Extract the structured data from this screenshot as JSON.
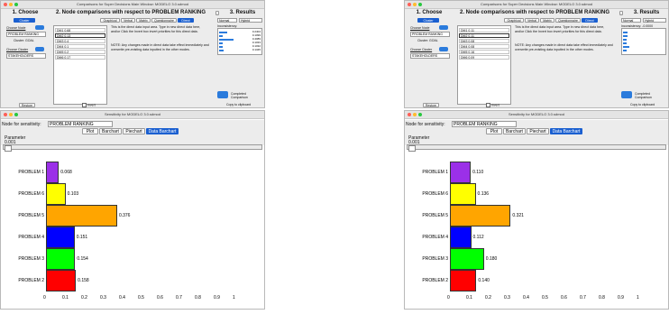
{
  "panels": [
    {
      "id": "left",
      "comparisons": {
        "window_title": "Comparisons for Super Decisions Main Window: MODELO 3.0.sdmod",
        "choose_header": "1. Choose",
        "node_header": "2. Node comparisons with respect to PROBLEM RANKING",
        "results_header": "3. Results",
        "cluster_tab": "Cluster",
        "view_tabs": [
          "Graphical",
          "Verbal",
          "Matrix",
          "Questionnaire",
          "Direct"
        ],
        "choose_node_label": "Choose Node",
        "node_value": "PROBLEM RANKING",
        "cluster_label": "Cluster: GOAL",
        "choose_cluster_label": "Choose Cluster",
        "cluster_value": "STAKEHOLDERS",
        "entries": [
          {
            "name": "DM1",
            "value": "0.68"
          },
          {
            "name": "DM2",
            "value": "0.13"
          },
          {
            "name": "DM3",
            "value": "0.4"
          },
          {
            "name": "DM4",
            "value": "0.1"
          },
          {
            "name": "DM5",
            "value": "0.2"
          },
          {
            "name": "DM6",
            "value": "0.17"
          }
        ],
        "note_text": "This is the direct data input area. Type in new direct data here, and/or Click the Invert box invert priorities for this direct data.",
        "note2_text": "NOTE: Any changes made in direct data take effect immediately and overwrite pre-existing data inputted in the other modes.",
        "normal_label": "Normal",
        "hybrid_label": "Hybrid",
        "inconsistency_label": "Inconsistency:",
        "result_values": [
          "0.2404",
          "0.1099",
          "0.4089",
          "0.1033",
          "0.1032",
          "0.1345"
        ],
        "restore_label": "Restore",
        "invert_label": "Invert",
        "completed_label": "Completed Comparison",
        "copy_label": "Copy to clipboard"
      },
      "sensitivity": {
        "window_title": "Sensitivity for MODELO 3.0.sdmod",
        "node_label": "Node for sensitivity:",
        "node_value": "PROBLEM RANKING",
        "tabs": [
          "Plot",
          "Barchart",
          "Piechart",
          "Data Barchart"
        ],
        "parameter_label": "Parameter",
        "parameter_value": "0.001"
      },
      "chart_data": {
        "type": "bar",
        "orientation": "horizontal",
        "categories": [
          "PROBLEM 1",
          "PROBLEM 6",
          "PROBLEM 5",
          "PROBLEM 4",
          "PROBLEM 3",
          "PROBLEM 2"
        ],
        "values": [
          0.068,
          0.103,
          0.376,
          0.151,
          0.154,
          0.158
        ],
        "value_labels": [
          "0.068",
          "0.103",
          "0.376",
          "0.151",
          "0.154",
          "0.158"
        ],
        "colors": [
          "#9b30e8",
          "#ffff00",
          "#ffa500",
          "#0000ff",
          "#00ff00",
          "#ff0000"
        ],
        "xlim": [
          0,
          1
        ],
        "xticks": [
          "0",
          "0.1",
          "0.2",
          "0.3",
          "0.4",
          "0.5",
          "0.6",
          "0.7",
          "0.8",
          "0.9",
          "1"
        ]
      }
    },
    {
      "id": "right",
      "comparisons": {
        "window_title": "Comparisons for Super Decisions Main Window: MODELO 3.0.sdmod",
        "choose_header": "1. Choose",
        "node_header": "2. Node comparisons with respect to PROBLEM RANKING",
        "results_header": "3. Results",
        "cluster_tab": "Cluster",
        "view_tabs": [
          "Graphical",
          "Verbal",
          "Matrix",
          "Questionnaire",
          "Direct"
        ],
        "choose_node_label": "Choose Node",
        "node_value": "PROBLEM RANKING",
        "cluster_label": "Cluster: GOAL",
        "choose_cluster_label": "Choose Cluster",
        "cluster_value": "STAKEHOLDERS",
        "entries": [
          {
            "name": "DM1",
            "value": "0.11"
          },
          {
            "name": "DM2",
            "value": "0.11"
          },
          {
            "name": "DM3",
            "value": "0.08"
          },
          {
            "name": "DM4",
            "value": "0.08"
          },
          {
            "name": "DM5",
            "value": "0.16"
          },
          {
            "name": "DM6",
            "value": "0.09"
          }
        ],
        "note_text": "This is the direct data input area. Type in new direct data here, and/or Click the Invert box invert priorities for this direct data.",
        "note2_text": "NOTE: Any changes made in direct data take effect immediately and overwrite pre-existing data inputted in the other modes.",
        "normal_label": "Normal",
        "hybrid_label": "Hybrid",
        "inconsistency_label": "Inconsistency: -0.0000",
        "result_values": [
          "",
          "",
          "",
          "",
          "",
          ""
        ],
        "restore_label": "Restore",
        "invert_label": "Invert",
        "completed_label": "Completed Comparison",
        "copy_label": "Copy to clipboard"
      },
      "sensitivity": {
        "window_title": "Sensitivity for MODELO 3.0.sdmod",
        "node_label": "Node for sensitivity:",
        "node_value": "PROBLEM RANKING",
        "tabs": [
          "Plot",
          "Barchart",
          "Piechart",
          "Data Barchart"
        ],
        "parameter_label": "Parameter",
        "parameter_value": "0.001"
      },
      "chart_data": {
        "type": "bar",
        "orientation": "horizontal",
        "categories": [
          "PROBLEM 1",
          "PROBLEM 6",
          "PROBLEM 5",
          "PROBLEM 4",
          "PROBLEM 3",
          "PROBLEM 2"
        ],
        "values": [
          0.11,
          0.136,
          0.321,
          0.112,
          0.18,
          0.14
        ],
        "value_labels": [
          "0.110",
          "0.136",
          "0.321",
          "0.112",
          "0.180",
          "0.140"
        ],
        "colors": [
          "#9b30e8",
          "#ffff00",
          "#ffa500",
          "#0000ff",
          "#00ff00",
          "#ff0000"
        ],
        "xlim": [
          0,
          1
        ],
        "xticks": [
          "0",
          "0.1",
          "0.2",
          "0.3",
          "0.4",
          "0.5",
          "0.6",
          "0.7",
          "0.8",
          "0.9",
          "1"
        ]
      }
    }
  ]
}
